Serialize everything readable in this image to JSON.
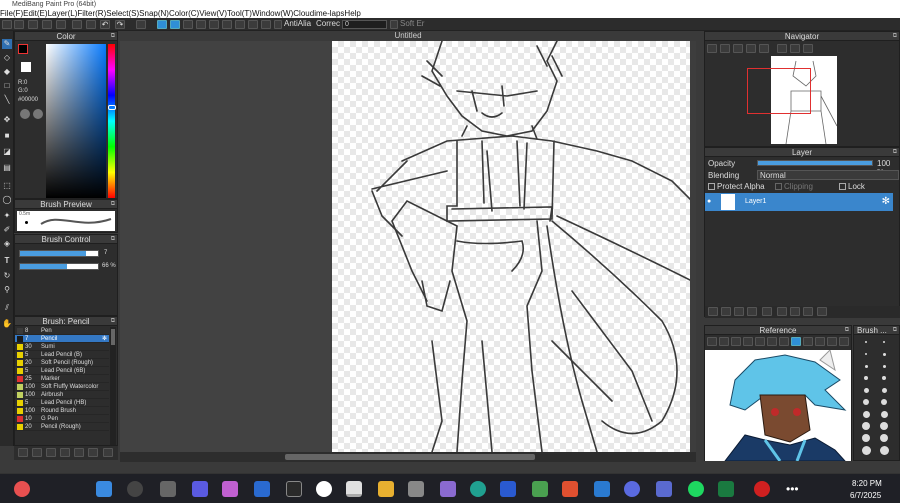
{
  "app": {
    "title": "MediBang Paint Pro (64bit)"
  },
  "menu": [
    "File(F)",
    "Edit(E)",
    "Layer(L)",
    "Filter(R)",
    "Select(S)",
    "Snap(N)",
    "Color(C)",
    "View(V)",
    "Tool(T)",
    "Window(W)",
    "Cloud",
    "ime-laps",
    "Help"
  ],
  "toolbar": {
    "antialias": "AntiAlia",
    "correct": "Correc",
    "correct_value": "0",
    "soft": "Soft Er"
  },
  "color_panel": {
    "title": "Color",
    "r": "R:0",
    "g": "G:0",
    "hex": "#00000"
  },
  "brush_preview": {
    "title": "Brush Preview",
    "size": "0.5m"
  },
  "brush_control": {
    "title": "Brush Control",
    "size_value": "7",
    "opacity_value": "66 %",
    "size_fraction": 0.85,
    "opacity_fraction": 0.6
  },
  "brush_list": {
    "title": "Brush: Pencil",
    "items": [
      {
        "size": "8",
        "name": "Pen",
        "color": "#3a3a3a"
      },
      {
        "size": "7",
        "name": "Pencil",
        "color": "#1a1a1a",
        "selected": true
      },
      {
        "size": "30",
        "name": "Sumi",
        "color": "#e8d000"
      },
      {
        "size": "5",
        "name": "Lead Pencil (B)",
        "color": "#e8d000"
      },
      {
        "size": "20",
        "name": "Soft Pencil (Rough)",
        "color": "#e8d000"
      },
      {
        "size": "5",
        "name": "Lead Pencil (6B)",
        "color": "#e8d000"
      },
      {
        "size": "25",
        "name": "Marker",
        "color": "#e03030"
      },
      {
        "size": "100",
        "name": "Soft Fluffy Watercolor",
        "color": "#c0d060"
      },
      {
        "size": "100",
        "name": "Airbrush",
        "color": "#c0d060"
      },
      {
        "size": "5",
        "name": "Lead Pencil (HB)",
        "color": "#e8d000"
      },
      {
        "size": "100",
        "name": "Round Brush",
        "color": "#e8d000"
      },
      {
        "size": "10",
        "name": "G Pen",
        "color": "#e03030"
      },
      {
        "size": "20",
        "name": "Pencil (Rough)",
        "color": "#e8d000"
      }
    ]
  },
  "canvas": {
    "title": "Untitled"
  },
  "navigator": {
    "title": "Navigator"
  },
  "layer_panel": {
    "title": "Layer",
    "opacity_label": "Opacity",
    "opacity_value": "100 %",
    "opacity_fraction": 1.0,
    "blending_label": "Blending",
    "blending_value": "Normal",
    "protect_alpha": "Protect Alpha",
    "clipping": "Clipping",
    "lock": "Lock",
    "layers": [
      {
        "name": "Layer1"
      }
    ]
  },
  "reference": {
    "title": "Reference"
  },
  "brush_size_panel": {
    "title": "Brush ..."
  },
  "taskbar": {
    "time": "8:20 PM",
    "date": "6/7/2025"
  }
}
